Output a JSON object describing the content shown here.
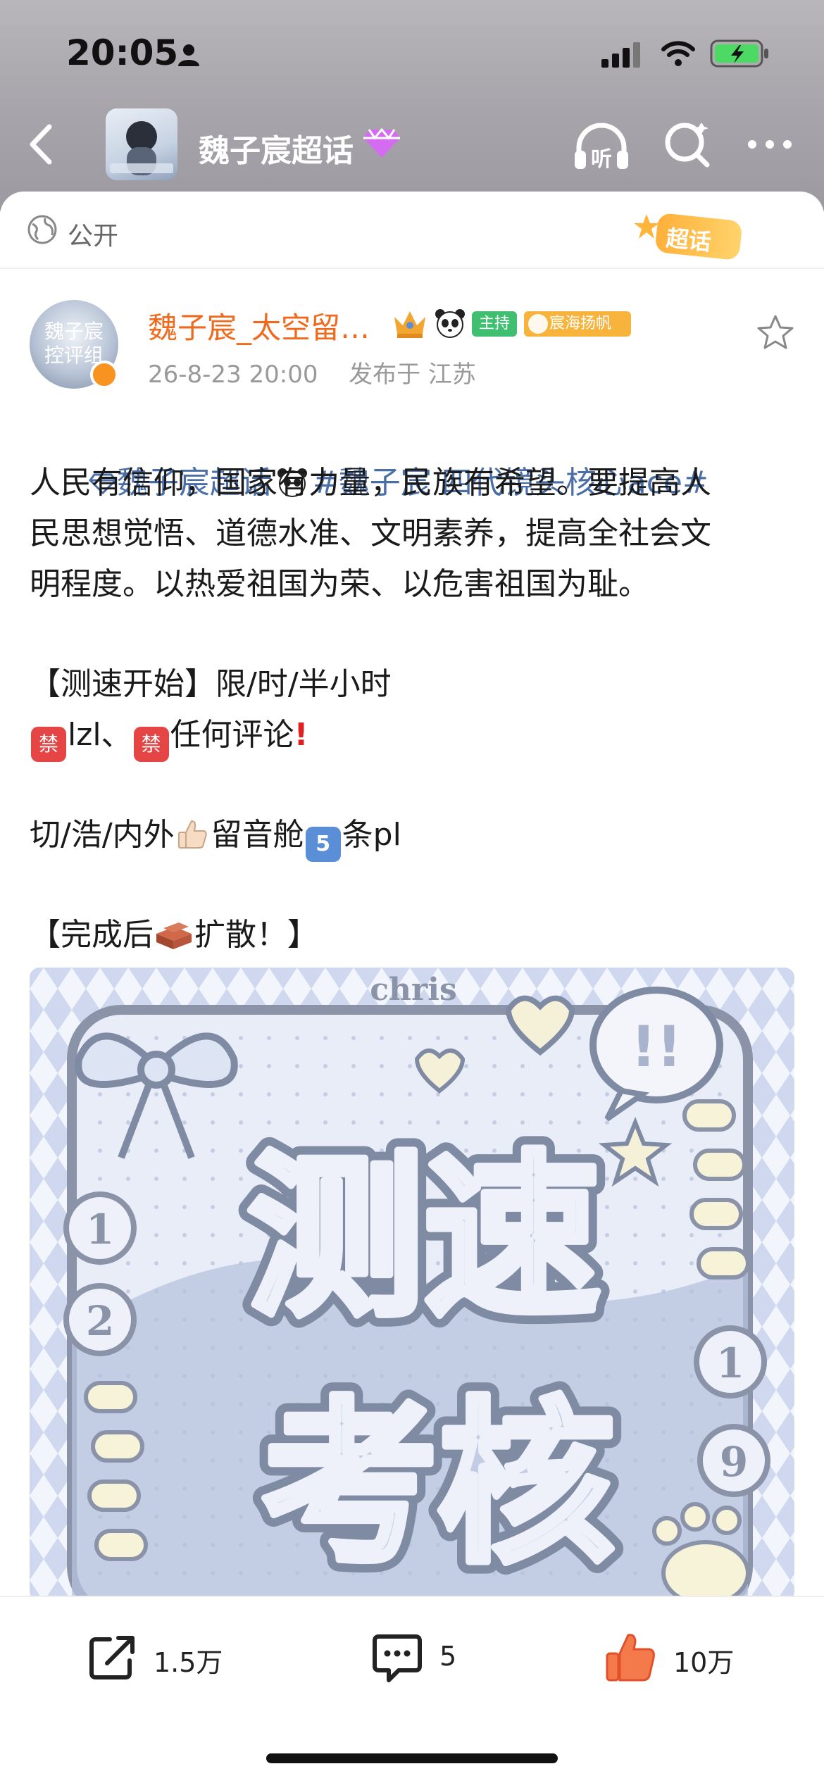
{
  "status_bar": {
    "time": "20:05"
  },
  "nav": {
    "topic_title": "魏子宸超话",
    "listen_label": "听"
  },
  "privacy": {
    "label": "公开"
  },
  "chaohua_logo": "超话",
  "post": {
    "avatar_text_line1": "魏子宸",
    "avatar_text_line2": "控评组",
    "username": "魏子宸_太空留…",
    "host_badge": "主持",
    "fan_badge": "宸海扬帆",
    "timestamp": "26-8-23 20:00",
    "location": "发布于 江苏",
    "topic_tag": "魏子宸超话",
    "hashtag": "#魏子宸 四代镜头核心ace#",
    "lines": [
      "人民有信仰，国家有力量，民族有希望。要提高人",
      "民思想觉悟、道德水准、文明素养，提高全社会文",
      "明程度。以热爱祖国为荣、以危害祖国为耻。"
    ],
    "speed_test": "【测速开始】限/时/半小时",
    "ban_label": "禁",
    "ban_lzl": "lzl、",
    "ban_rest": "任何评论",
    "inside_outside": "切/浩/内外",
    "voice": "留音舱",
    "five_emoji": "5",
    "count_pl": "条pl",
    "spread_pre": "【完成后",
    "spread_post": "扩散！】"
  },
  "image": {
    "watermark": "chris",
    "title_line1": "测速",
    "title_line2": "考核",
    "number_left_1": "1",
    "number_left_2": "2",
    "number_right_1": "1",
    "number_right_2": "9",
    "exclaim": "!!"
  },
  "actions": {
    "share_count": "1.5万",
    "comment_count": "5",
    "like_count": "10万"
  },
  "colors": {
    "username": "#f06a1d",
    "topic_link": "#4a6ea8",
    "host_badge": "#3fbf6f",
    "fan_badge": "#f8b33d",
    "like": "#f05a32"
  }
}
